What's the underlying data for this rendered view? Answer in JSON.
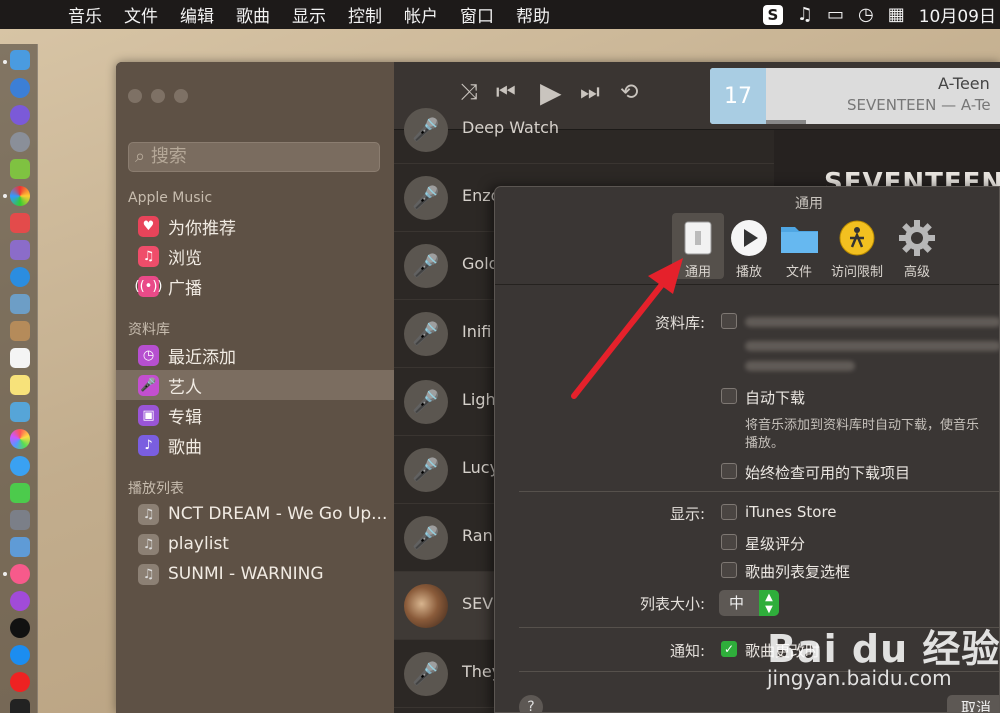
{
  "menubar": {
    "apple": "",
    "items": [
      "音乐",
      "文件",
      "编辑",
      "歌曲",
      "显示",
      "控制",
      "帐户",
      "窗口",
      "帮助"
    ],
    "clock": "10月09日"
  },
  "sidebar": {
    "search_placeholder": "搜索",
    "apple_music_header": "Apple Music",
    "apple_music": [
      {
        "label": "为你推荐",
        "icon": "heart-icon",
        "color": "#e8445a"
      },
      {
        "label": "浏览",
        "icon": "music-note-icon",
        "color": "#ef4d6a"
      },
      {
        "label": "广播",
        "icon": "radio-icon",
        "color": "#e94a88"
      }
    ],
    "library_header": "资料库",
    "library": [
      {
        "label": "最近添加",
        "icon": "clock-icon",
        "color": "#b64fd0"
      },
      {
        "label": "艺人",
        "icon": "microphone-icon",
        "color": "#c34fd0",
        "selected": true
      },
      {
        "label": "专辑",
        "icon": "album-icon",
        "color": "#9a55d6"
      },
      {
        "label": "歌曲",
        "icon": "music-note-icon",
        "color": "#7a5ee0"
      }
    ],
    "playlists_header": "播放列表",
    "playlists": [
      {
        "label": "NCT DREAM - We Go Up..."
      },
      {
        "label": "playlist"
      },
      {
        "label": "SUNMI - WARNING"
      }
    ]
  },
  "nowplaying": {
    "title": "A-Teen",
    "subtitle": "SEVENTEEN — A-Te"
  },
  "artists": [
    "Deep Watch",
    "Enzo",
    "Gold",
    "Inifi",
    "Ligh",
    "Lucy",
    "Rani",
    "SEV",
    "They"
  ],
  "detail_heading": "SEVENTEEN",
  "prefs": {
    "title": "通用",
    "tabs": [
      {
        "label": "通用",
        "icon": "switch-icon",
        "selected": true
      },
      {
        "label": "播放",
        "icon": "play-icon"
      },
      {
        "label": "文件",
        "icon": "folder-icon"
      },
      {
        "label": "访问限制",
        "icon": "parental-icon"
      },
      {
        "label": "高级",
        "icon": "gear-icon"
      }
    ],
    "library_label": "资料库:",
    "auto_download": "自动下载",
    "auto_download_desc": "将音乐添加到资料库时自动下载，使音乐",
    "auto_download_desc2": "播放。",
    "check_downloads": "始终检查可用的下载项目",
    "show_label": "显示:",
    "show_itunes_store": "iTunes Store",
    "show_star_rating": "星级评分",
    "show_song_checkbox": "歌曲列表复选框",
    "list_size_label": "列表大小:",
    "list_size_value": "中",
    "notify_label": "通知:",
    "notify_song_change": "歌曲更改时",
    "help": "?",
    "cancel": "取消"
  },
  "watermark": {
    "logo": "Bai du 经验",
    "url": "jingyan.baidu.com"
  },
  "colors": {
    "accent_green": "#2fae3b",
    "arrow_red": "#e5212b"
  }
}
